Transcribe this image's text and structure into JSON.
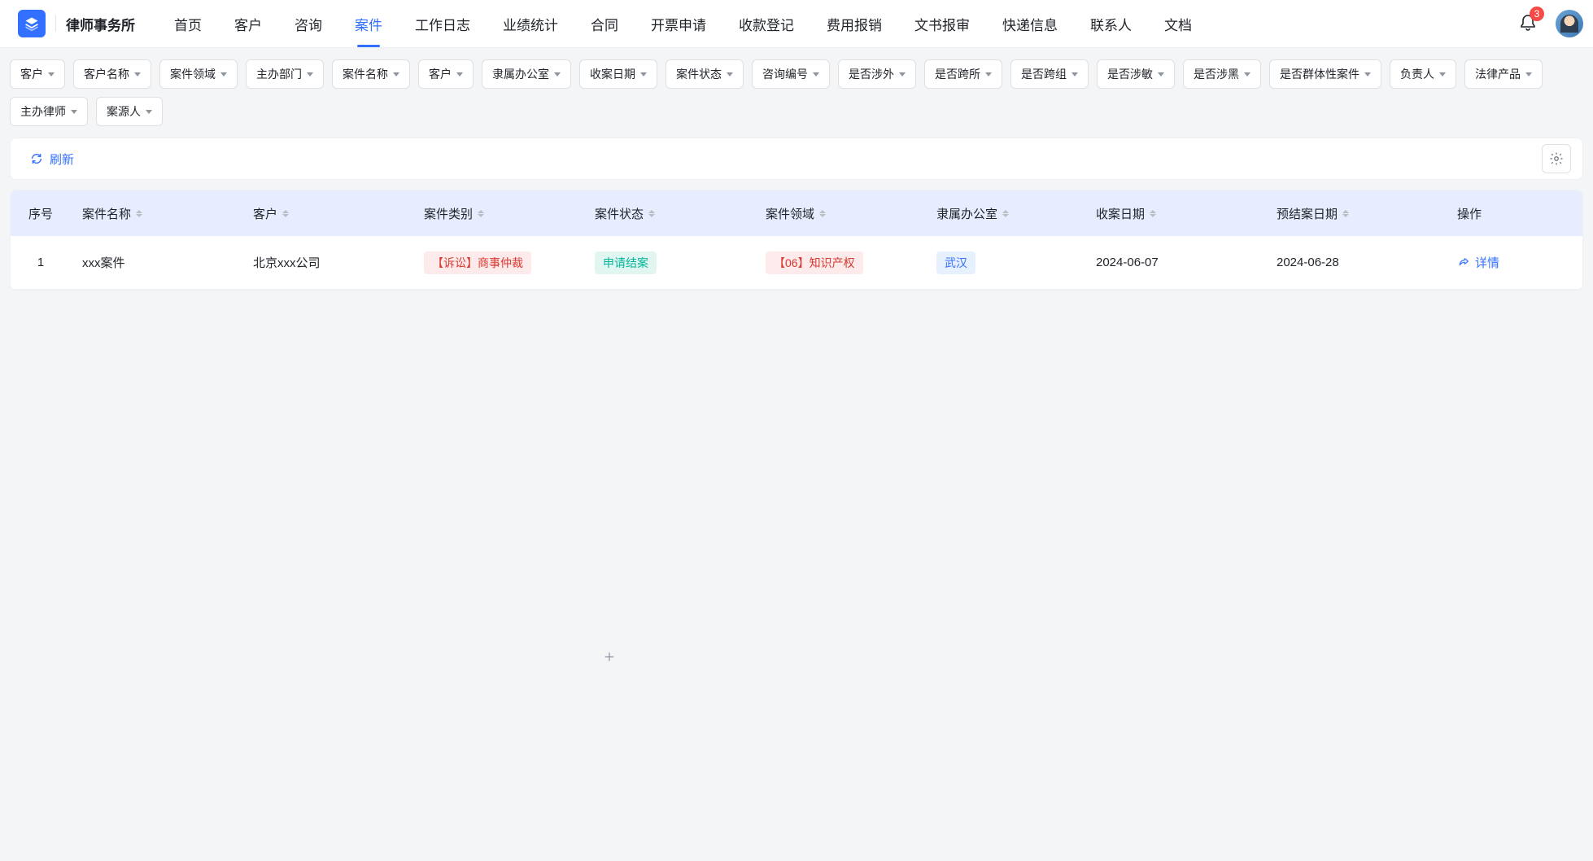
{
  "brand": "律师事务所",
  "nav": {
    "items": [
      "首页",
      "客户",
      "咨询",
      "案件",
      "工作日志",
      "业绩统计",
      "合同",
      "开票申请",
      "收款登记",
      "费用报销",
      "文书报审",
      "快递信息",
      "联系人",
      "文档"
    ],
    "active_index": 3
  },
  "notifications": {
    "count": "3"
  },
  "filters": {
    "row": [
      "客户",
      "客户名称",
      "案件领域",
      "主办部门",
      "案件名称",
      "客户",
      "隶属办公室",
      "收案日期",
      "案件状态",
      "咨询编号",
      "是否涉外",
      "是否跨所",
      "是否跨组",
      "是否涉敏",
      "是否涉黑",
      "是否群体性案件",
      "负责人",
      "法律产品",
      "主办律师",
      "案源人"
    ]
  },
  "toolbar": {
    "refresh": "刷新"
  },
  "table": {
    "headers": [
      "序号",
      "案件名称",
      "客户",
      "案件类别",
      "案件状态",
      "案件领域",
      "隶属办公室",
      "收案日期",
      "预结案日期",
      "操作"
    ],
    "rows": [
      {
        "idx": "1",
        "name": "xxx案件",
        "client": "北京xxx公司",
        "type": "【诉讼】商事仲裁",
        "status": "申请结案",
        "field": "【06】知识产权",
        "office": "武汉",
        "date1": "2024-06-07",
        "date2": "2024-06-28",
        "action": "详情"
      }
    ]
  }
}
